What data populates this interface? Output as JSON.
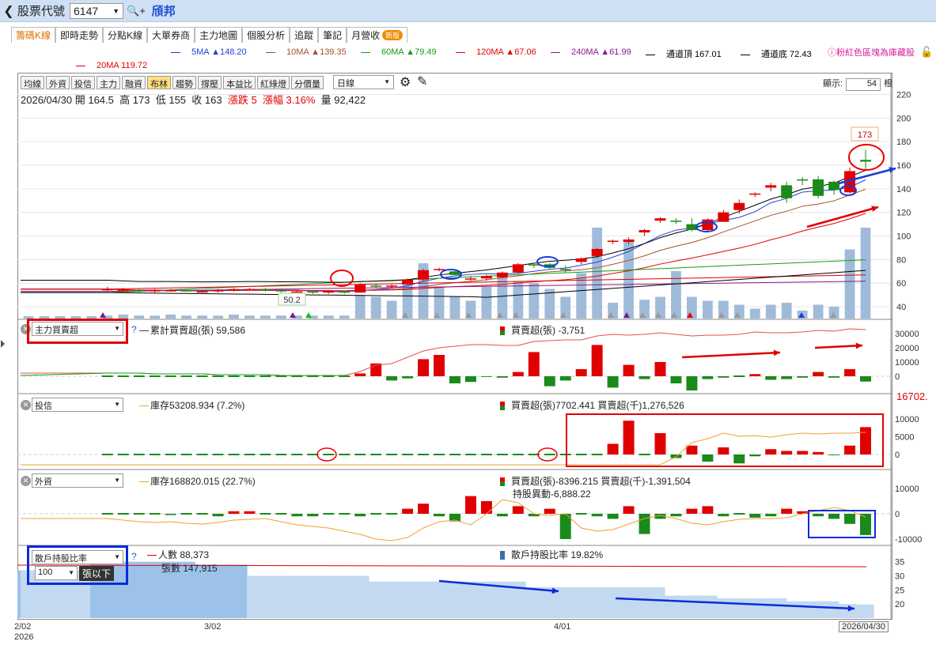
{
  "topbar": {
    "back_icon": "chevron-left-icon",
    "label": "股票代號",
    "code": "6147",
    "name": "頎邦"
  },
  "tabs": [
    {
      "label": "籌碼K線",
      "active": true
    },
    {
      "label": "即時走勢"
    },
    {
      "label": "分點K線"
    },
    {
      "label": "大單券商"
    },
    {
      "label": "主力地圖"
    },
    {
      "label": "個股分析"
    },
    {
      "label": "追蹤"
    },
    {
      "label": "筆記"
    },
    {
      "label": "月營收",
      "badge": "新版"
    }
  ],
  "ma_legend": [
    {
      "text": "5MA ▲148.20",
      "color": "#2244cc"
    },
    {
      "text": "10MA ▲139.35",
      "color": "#a0522d"
    },
    {
      "text": "60MA ▲79.49",
      "color": "#1a9a1a"
    },
    {
      "text": "120MA ▲67.06",
      "color": "#e00000"
    },
    {
      "text": "240MA ▲61.99",
      "color": "#8b1a8b"
    },
    {
      "text": "通道頂 167.01",
      "color": "#000000"
    },
    {
      "text": "通道底 72.43",
      "color": "#000000"
    },
    {
      "text": "20MA 119.72",
      "color": "#e00000"
    }
  ],
  "legend_note": "粉紅色區塊為庫藏股",
  "toolbar": [
    "均線",
    "外資",
    "投信",
    "主力",
    "融資",
    "布林",
    "趨勢",
    "撐壓",
    "本益比",
    "紅綠燈",
    "分價量"
  ],
  "toolbar_on": "布林",
  "period": "日線",
  "display_label": "顯示:",
  "display_count": "54",
  "display_unit": "根",
  "info": {
    "date": "2026/04/30",
    "open_label": "開",
    "open": "164.5",
    "high_label": "高",
    "high": "173",
    "low_label": "低",
    "low": "155",
    "close_label": "收",
    "close": "163",
    "chg": "漲跌 5",
    "pct": "漲幅 3.16%",
    "vol_label": "量",
    "vol": "92,422"
  },
  "price_axis": [
    "220",
    "200",
    "180",
    "160",
    "140",
    "120",
    "100",
    "80",
    "60",
    "40"
  ],
  "price_marks": {
    "high": "173",
    "low": "50.2"
  },
  "panel1": {
    "select": "主力買賣超",
    "line": "累計買賣超(張) 59,586",
    "bar": "買賣超(張) -3,751",
    "axis": [
      "30000",
      "20000",
      "10000",
      "0"
    ]
  },
  "panel2": {
    "select": "投信",
    "line": "庫存53208.934 (7.2%)",
    "bar": "買賣超(張)7702.441 買賣超(千)1,276,526",
    "axis": [
      "10000",
      "5000",
      "0"
    ],
    "overflow": "16702."
  },
  "panel3": {
    "select": "外資",
    "line": "庫存168820.015 (22.7%)",
    "bar": "買賣超(張)-8396.215 買賣超(千)-1,391,504",
    "bar2": "持股異動-6,888.22",
    "axis": [
      "10000",
      "0",
      "-10000"
    ]
  },
  "panel4": {
    "select": "散戶持股比率",
    "sub_select": "100",
    "sub_unit": "張以下",
    "line1": "人數 88,373",
    "line2": "張數 147,915",
    "bar": "散戶持股比率 19.82%",
    "axis": [
      "35",
      "30",
      "25",
      "20"
    ]
  },
  "x_axis": [
    "2/02",
    "2026",
    "3/02",
    "4/01",
    "2026/04/30"
  ],
  "chart_data": [
    {
      "type": "candlestick",
      "title": "2026/04/30 開 164.5 高 173 低 155 收 163",
      "ylim": [
        30,
        225
      ],
      "ohlc": [
        [
          55,
          57,
          53,
          55
        ],
        [
          54,
          56,
          53,
          54
        ],
        [
          54,
          55,
          52,
          53
        ],
        [
          53,
          55,
          52,
          54
        ],
        [
          54,
          55,
          53,
          54
        ],
        [
          54,
          55,
          53,
          53
        ],
        [
          53,
          54,
          52,
          53
        ],
        [
          53,
          55,
          52,
          54
        ],
        [
          54,
          56,
          53,
          55
        ],
        [
          55,
          56,
          54,
          55
        ],
        [
          55,
          56,
          53,
          54
        ],
        [
          54,
          55,
          52,
          53
        ],
        [
          53,
          54,
          52,
          53
        ],
        [
          53,
          54,
          51,
          52
        ],
        [
          52,
          54,
          51,
          53
        ],
        [
          53,
          54,
          51,
          52
        ],
        [
          52,
          60,
          52,
          59
        ],
        [
          58,
          60,
          56,
          57
        ],
        [
          57,
          59,
          56,
          58
        ],
        [
          59,
          64,
          58,
          63
        ],
        [
          63,
          72,
          62,
          71
        ],
        [
          71,
          73,
          70,
          72
        ],
        [
          70,
          72,
          67,
          67
        ],
        [
          63,
          66,
          62,
          64
        ],
        [
          64,
          67,
          62,
          66
        ],
        [
          65,
          70,
          64,
          69
        ],
        [
          69,
          77,
          68,
          76
        ],
        [
          76,
          77,
          73,
          75
        ],
        [
          76,
          77,
          72,
          73
        ],
        [
          72,
          75,
          69,
          71
        ],
        [
          78,
          82,
          76,
          81
        ],
        [
          83,
          90,
          81,
          89
        ],
        [
          96,
          97,
          93,
          96
        ],
        [
          95,
          99,
          93,
          97
        ],
        [
          103,
          106,
          100,
          105
        ],
        [
          113,
          116,
          111,
          115
        ],
        [
          113,
          115,
          110,
          112
        ],
        [
          110,
          115,
          104,
          105
        ],
        [
          105,
          115,
          103,
          114
        ],
        [
          112,
          122,
          112,
          120
        ],
        [
          122,
          131,
          119,
          128
        ],
        [
          135,
          137,
          133,
          136
        ],
        [
          141,
          145,
          138,
          143
        ],
        [
          143,
          146,
          128,
          132
        ],
        [
          148,
          150,
          143,
          147
        ],
        [
          148,
          151,
          132,
          134
        ],
        [
          146,
          147,
          135,
          139
        ],
        [
          137,
          158,
          136,
          155
        ],
        [
          164.5,
          173,
          155,
          163
        ]
      ],
      "volume": [
        3,
        4,
        3,
        3,
        4,
        3,
        3,
        3,
        4,
        3,
        3,
        3,
        3,
        3,
        3,
        3,
        24,
        22,
        18,
        36,
        56,
        32,
        22,
        18,
        32,
        44,
        38,
        36,
        30,
        22,
        46,
        92,
        16,
        78,
        19,
        22,
        48,
        22,
        18,
        18,
        14,
        10,
        14,
        16,
        8,
        14,
        12,
        70,
        92
      ],
      "series": [
        {
          "name": "5MA",
          "last": 148.2
        },
        {
          "name": "10MA",
          "last": 139.35
        },
        {
          "name": "20MA",
          "last": 119.72
        },
        {
          "name": "60MA",
          "last": 79.49
        },
        {
          "name": "120MA",
          "last": 67.06
        },
        {
          "name": "240MA",
          "last": 61.99
        },
        {
          "name": "通道頂",
          "last": 167.01
        },
        {
          "name": "通道底",
          "last": 72.43
        }
      ]
    },
    {
      "type": "bar",
      "title": "主力買賣超",
      "values": [
        0,
        0,
        0,
        0,
        0,
        0,
        0,
        0,
        0,
        0,
        0,
        0,
        0,
        0,
        0,
        0,
        2000,
        9000,
        -3000,
        -1500,
        12000,
        15000,
        -5000,
        -4000,
        -500,
        -1000,
        3000,
        17000,
        -7000,
        -3000,
        5000,
        22000,
        -8000,
        8000,
        -2000,
        10000,
        -5000,
        -10000,
        -2000,
        -1000,
        0,
        1500,
        -2500,
        -2000,
        -1000,
        3000,
        -1000,
        5000,
        -3751
      ],
      "ylim": [
        -12000,
        32000
      ]
    },
    {
      "type": "bar",
      "title": "投信",
      "values": [
        0,
        0,
        0,
        0,
        0,
        0,
        0,
        0,
        0,
        0,
        0,
        0,
        0,
        0,
        0,
        0,
        0,
        0,
        0,
        0,
        0,
        0,
        0,
        0,
        0,
        0,
        0,
        0,
        0,
        0,
        0,
        0,
        0,
        0,
        0,
        0,
        3000,
        9500,
        0,
        6000,
        -1000,
        2500,
        -2000,
        2000,
        -2500,
        -500,
        1500,
        1000,
        1000,
        700,
        -200,
        2500,
        7702
      ],
      "ylim": [
        -3000,
        14000
      ]
    },
    {
      "type": "bar",
      "title": "外資",
      "values": [
        0,
        0,
        0,
        0,
        0,
        -500,
        0,
        0,
        -1000,
        1000,
        1000,
        0,
        0,
        -1000,
        -1000,
        0,
        0,
        -1000,
        0,
        0,
        2000,
        4000,
        -1000,
        -3000,
        7000,
        5000,
        -1000,
        3000,
        -1000,
        2000,
        -10000,
        0,
        -1000,
        -2000,
        3000,
        -8000,
        -2000,
        -1000,
        2000,
        3000,
        -1000,
        0,
        -1500,
        -1000,
        2000,
        1000,
        -1000,
        -2000,
        -4000,
        -8396
      ],
      "ylim": [
        -12000,
        12000
      ]
    },
    {
      "type": "area",
      "title": "散戶持股比率",
      "values": [
        32,
        32,
        32,
        32,
        35,
        35,
        35,
        35,
        35,
        35,
        34,
        34,
        34,
        30,
        30,
        30,
        30,
        30,
        30,
        30,
        28,
        28,
        28,
        28,
        28,
        28,
        28,
        28,
        28,
        26,
        26,
        26,
        26,
        26,
        26,
        26,
        26,
        23,
        23,
        23,
        22,
        22,
        22,
        22,
        21,
        21,
        21,
        20,
        19.82
      ],
      "ylim": [
        15,
        38
      ]
    }
  ]
}
